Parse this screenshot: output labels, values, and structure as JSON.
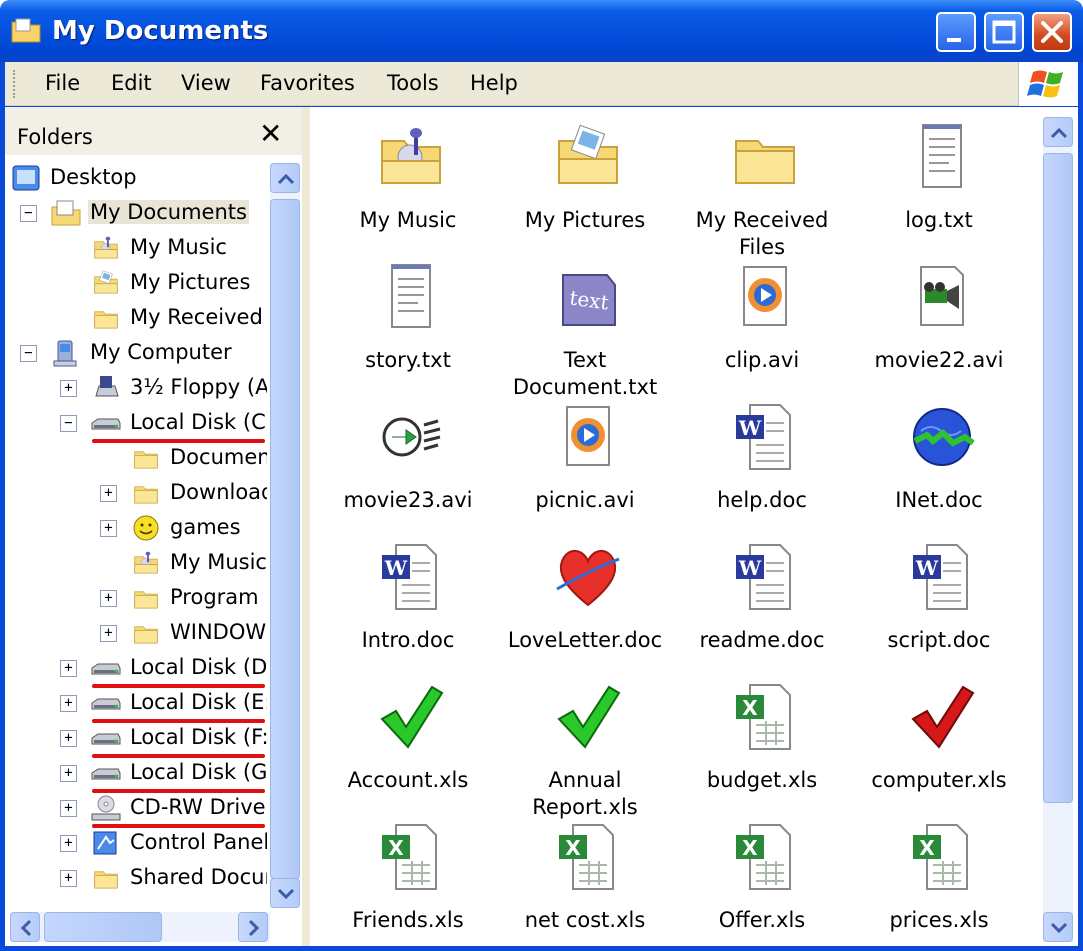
{
  "window": {
    "title": "My Documents"
  },
  "menu": [
    "File",
    "Edit",
    "View",
    "Favorites",
    "Tools",
    "Help"
  ],
  "folders_pane": {
    "title": "Folders",
    "close_glyph": "✕"
  },
  "tree": [
    {
      "label": "Desktop",
      "icon": "desktop-icon",
      "expander": "",
      "selected": false
    },
    {
      "label": "My Documents",
      "icon": "my-documents-icon",
      "expander": "−",
      "selected": true
    },
    {
      "label": "My Music",
      "icon": "music-folder-icon",
      "expander": "",
      "selected": false
    },
    {
      "label": "My Pictures",
      "icon": "pictures-folder-icon",
      "expander": "",
      "selected": false
    },
    {
      "label": "My Received",
      "icon": "folder-icon",
      "expander": "",
      "selected": false
    },
    {
      "label": "My Computer",
      "icon": "computer-icon",
      "expander": "−",
      "selected": false
    },
    {
      "label": "3½ Floppy (A",
      "icon": "floppy-icon",
      "expander": "+",
      "selected": false
    },
    {
      "label": "Local Disk (C:",
      "icon": "disk-icon",
      "expander": "−",
      "selected": false
    },
    {
      "label": "Document",
      "icon": "folder-icon",
      "expander": "",
      "selected": false
    },
    {
      "label": "Download",
      "icon": "folder-icon",
      "expander": "+",
      "selected": false
    },
    {
      "label": "games",
      "icon": "smiley-icon",
      "expander": "+",
      "selected": false
    },
    {
      "label": "My Music",
      "icon": "music-folder-icon",
      "expander": "",
      "selected": false
    },
    {
      "label": "Program F",
      "icon": "folder-icon",
      "expander": "+",
      "selected": false
    },
    {
      "label": "WINDOW",
      "icon": "folder-icon",
      "expander": "+",
      "selected": false
    },
    {
      "label": "Local Disk (D:",
      "icon": "disk-icon",
      "expander": "+",
      "selected": false
    },
    {
      "label": "Local Disk (E:",
      "icon": "disk-icon",
      "expander": "+",
      "selected": false
    },
    {
      "label": "Local Disk (F:",
      "icon": "disk-icon",
      "expander": "+",
      "selected": false
    },
    {
      "label": "Local Disk (G:",
      "icon": "disk-icon",
      "expander": "+",
      "selected": false
    },
    {
      "label": "CD-RW Drive",
      "icon": "cd-drive-icon",
      "expander": "+",
      "selected": false
    },
    {
      "label": "Control Panel",
      "icon": "control-panel-icon",
      "expander": "+",
      "selected": false
    },
    {
      "label": "Shared Docur",
      "icon": "folder-icon",
      "expander": "+",
      "selected": false
    }
  ],
  "files": [
    {
      "name": "My Music",
      "icon": "music-folder-icon"
    },
    {
      "name": "My Pictures",
      "icon": "pictures-folder-icon"
    },
    {
      "name": "My Received Files",
      "icon": "folder-icon"
    },
    {
      "name": "log.txt",
      "icon": "text-file-icon"
    },
    {
      "name": "story.txt",
      "icon": "text-file-icon"
    },
    {
      "name": "Text Document.txt",
      "icon": "text-doc-icon"
    },
    {
      "name": "clip.avi",
      "icon": "media-player-icon"
    },
    {
      "name": "movie22.avi",
      "icon": "video-camera-icon"
    },
    {
      "name": "movie23.avi",
      "icon": "arrow-circle-icon"
    },
    {
      "name": "picnic.avi",
      "icon": "media-player-icon"
    },
    {
      "name": "help.doc",
      "icon": "word-doc-icon"
    },
    {
      "name": "INet.doc",
      "icon": "globe-icon"
    },
    {
      "name": "Intro.doc",
      "icon": "word-doc-icon"
    },
    {
      "name": "LoveLetter.doc",
      "icon": "heart-icon"
    },
    {
      "name": "readme.doc",
      "icon": "word-doc-icon"
    },
    {
      "name": "script.doc",
      "icon": "word-doc-icon"
    },
    {
      "name": "Account.xls",
      "icon": "green-check-icon"
    },
    {
      "name": "Annual Report.xls",
      "icon": "green-check-icon"
    },
    {
      "name": "budget.xls",
      "icon": "excel-doc-icon"
    },
    {
      "name": "computer.xls",
      "icon": "red-check-icon"
    },
    {
      "name": "Friends.xls",
      "icon": "excel-doc-icon"
    },
    {
      "name": "net cost.xls",
      "icon": "excel-doc-icon"
    },
    {
      "name": "Offer.xls",
      "icon": "excel-doc-icon"
    },
    {
      "name": "prices.xls",
      "icon": "excel-doc-icon"
    }
  ],
  "annotations": {
    "underline_color": "#e01010"
  }
}
